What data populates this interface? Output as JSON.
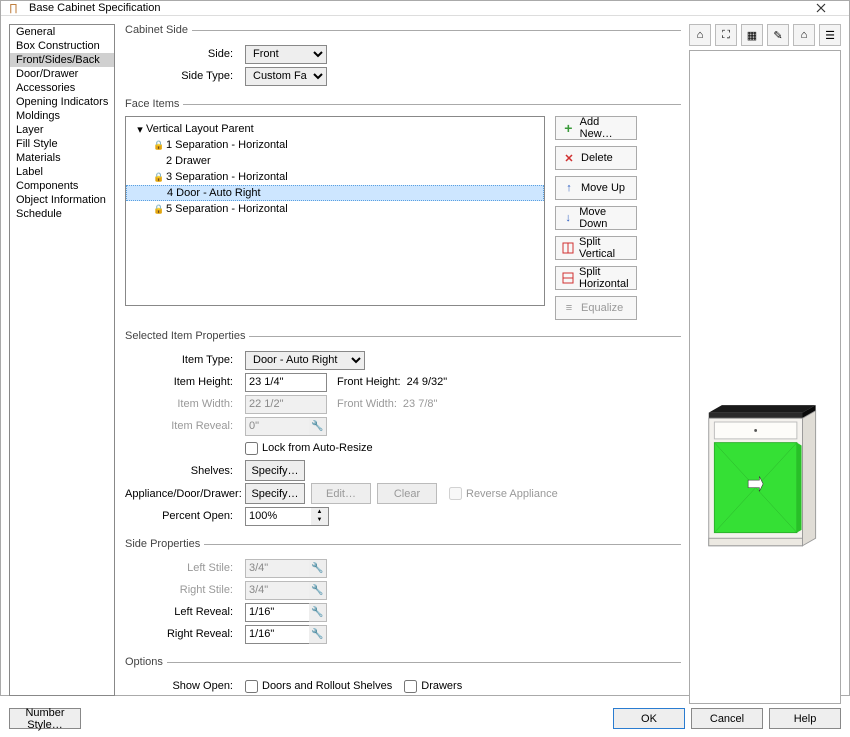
{
  "title": "Base Cabinet Specification",
  "sidebar": {
    "items": [
      {
        "label": "General"
      },
      {
        "label": "Box Construction"
      },
      {
        "label": "Front/Sides/Back"
      },
      {
        "label": "Door/Drawer"
      },
      {
        "label": "Accessories"
      },
      {
        "label": "Opening Indicators"
      },
      {
        "label": "Moldings"
      },
      {
        "label": "Layer"
      },
      {
        "label": "Fill Style"
      },
      {
        "label": "Materials"
      },
      {
        "label": "Label"
      },
      {
        "label": "Components"
      },
      {
        "label": "Object Information"
      },
      {
        "label": "Schedule"
      }
    ],
    "selected_index": 2
  },
  "cabinet_side": {
    "legend": "Cabinet Side",
    "side_label": "Side:",
    "side_value": "Front",
    "side_type_label": "Side Type:",
    "side_type_value": "Custom Face"
  },
  "face_items": {
    "legend": "Face Items",
    "root": "Vertical Layout Parent",
    "items": [
      {
        "n": "1",
        "label": "Separation - Horizontal",
        "locked": true
      },
      {
        "n": "2",
        "label": "Drawer",
        "locked": false
      },
      {
        "n": "3",
        "label": "Separation - Horizontal",
        "locked": true
      },
      {
        "n": "4",
        "label": "Door - Auto Right",
        "locked": false
      },
      {
        "n": "5",
        "label": "Separation - Horizontal",
        "locked": true
      }
    ],
    "selected_index": 3,
    "buttons": {
      "add": "Add New…",
      "delete": "Delete",
      "move_up": "Move Up",
      "move_down": "Move Down",
      "split_v": "Split Vertical",
      "split_h": "Split Horizontal",
      "equalize": "Equalize"
    }
  },
  "selected_item": {
    "legend": "Selected Item Properties",
    "type_label": "Item Type:",
    "type_value": "Door - Auto Right",
    "height_label": "Item Height:",
    "height_value": "23 1/4\"",
    "front_height_label": "Front Height:",
    "front_height_value": "24 9/32\"",
    "width_label": "Item Width:",
    "width_value": "22 1/2\"",
    "front_width_label": "Front Width:",
    "front_width_value": "23 7/8\"",
    "reveal_label": "Item Reveal:",
    "reveal_value": "0\"",
    "lock_label": "Lock from Auto-Resize",
    "shelves_label": "Shelves:",
    "specify_label": "Specify…",
    "add_label": "Appliance/Door/Drawer:",
    "edit_label": "Edit…",
    "clear_label": "Clear",
    "reverse_label": "Reverse Appliance",
    "percent_label": "Percent Open:",
    "percent_value": "100%"
  },
  "side_properties": {
    "legend": "Side Properties",
    "left_stile_label": "Left Stile:",
    "left_stile_value": "3/4\"",
    "right_stile_label": "Right Stile:",
    "right_stile_value": "3/4\"",
    "left_reveal_label": "Left Reveal:",
    "left_reveal_value": "1/16\"",
    "right_reveal_label": "Right Reveal:",
    "right_reveal_value": "1/16\""
  },
  "options": {
    "legend": "Options",
    "show_open_label": "Show Open:",
    "doors_label": "Doors and Rollout Shelves",
    "drawers_label": "Drawers"
  },
  "footer": {
    "number_style": "Number Style…",
    "ok": "OK",
    "cancel": "Cancel",
    "help": "Help"
  },
  "toolbar_icons": [
    "house-view-icon",
    "expand-icon",
    "window-icon",
    "tools-icon",
    "home-color-icon",
    "settings-icon"
  ],
  "chart_data": {
    "type": "diagram",
    "description": "3D preview of base cabinet: dark top counter, single drawer with round pull below, large green-highlighted door below drawer representing the selected 'Door - Auto Right' face item, plinth at base."
  }
}
